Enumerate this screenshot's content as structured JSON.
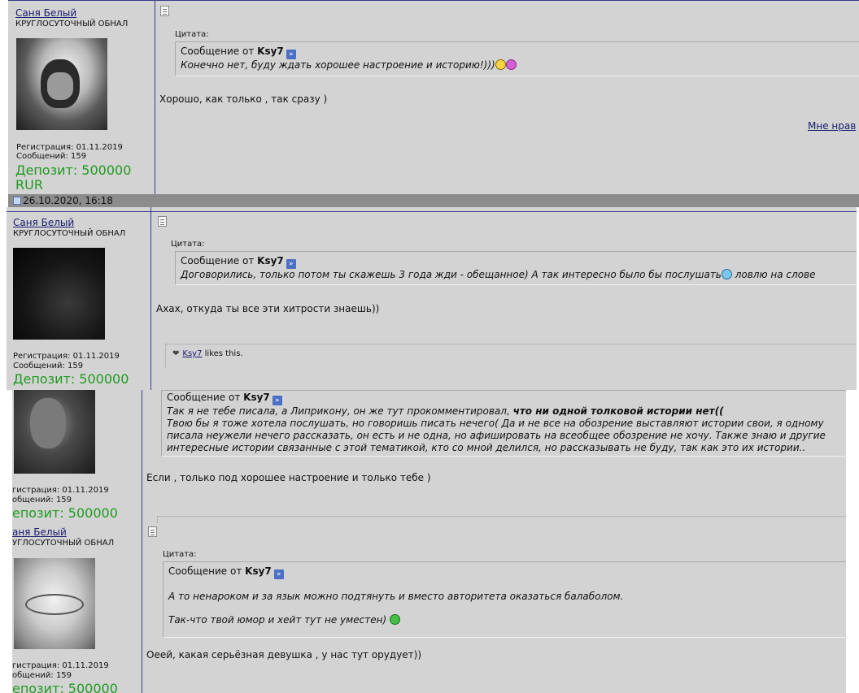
{
  "user": {
    "name": "Саня Белый",
    "title": "КРУГЛОСУТОЧНЫЙ ОБНАЛ",
    "registration": "Регистрация: 01.11.2019",
    "messages": "Сообщений: 159",
    "deposit_line1": "Депозит: 500000",
    "deposit_line2": "RUR",
    "registration_cut": "гистрация: 01.11.2019",
    "messages_cut": "общений: 159",
    "deposit_cut": "епозит: 500000",
    "name_cut": "аня Белый",
    "title_cut": "УГЛОСУТОЧНЫЙ ОБНАЛ"
  },
  "quote_label": "Цитата:",
  "quote_author_prefix": "Сообщение от",
  "quote_author": "Ksy7",
  "date_bar": "26.10.2020, 16:18",
  "posts": [
    {
      "quote": "Конечно нет, буду ждать хорошее настроение и историю!)))",
      "message": "Хорошо, как только , так сразу )",
      "like_link": "Мне нрав"
    },
    {
      "quote": "Договорились, только потом ты скажешь 3 года жди - обещанное) А так интересно было бы послушать",
      "quote_tail": "ловлю на слове",
      "message": "Ахах, откуда ты все эти хитрости знаешь))",
      "likes_user": "Ksy7",
      "likes_text": "likes this."
    },
    {
      "quote_line1_a": "Так я не тебе писала, а Липрикону, он же тут прокомментировал,",
      "quote_line1_b": "что ни одной толковой истории нет((",
      "quote_line2": "Твою бы я тоже хотела послушать, но говоришь писать нечего( Да и не все на обозрение выставляют истории свои, я одному",
      "quote_line3": "писала неужели нечего рассказать, он есть и не одна, но афишировать на всеобщее обозрение не хочу. Также знаю и другие",
      "quote_line4": "интересные истории связанные с этой тематикой, кто со мной делился, но рассказывать не буду, так как это их истории..",
      "message": "Если , только под хорошее настроение и только тебе )"
    },
    {
      "quote_line1": "А то ненароком и за язык можно подтянуть и вместо авторитета оказаться балаболом.",
      "quote_line2": "Так-что твой юмор и хейт тут не уместен)",
      "message": "Оеей, какая серьёзная девушка , у нас тут орудует))"
    }
  ],
  "colors": {
    "panel_bg": "#d3d3d3",
    "username": "#1a1a6e",
    "deposit": "#1f9a1f",
    "border": "#3a3a8a",
    "date_bar": "#8c8c8c"
  },
  "icons": [
    "post-icon",
    "arrow-icon",
    "smiley-icon",
    "heart-icon"
  ]
}
